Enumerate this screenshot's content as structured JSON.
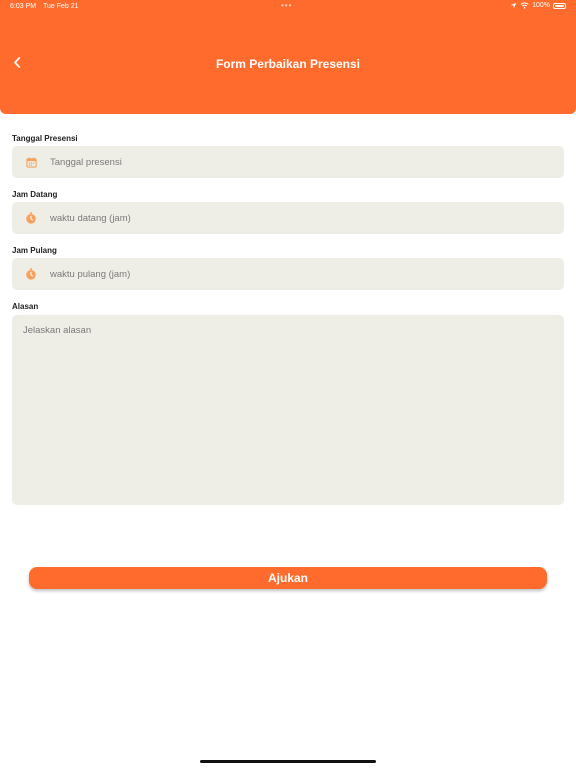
{
  "status_bar": {
    "time": "6:03 PM",
    "date": "Tue Feb 21",
    "dots": "•••",
    "battery": "100%"
  },
  "header": {
    "title": "Form Perbaikan Presensi",
    "back_icon": "chevron-left-icon",
    "color": "#FF6B2C"
  },
  "form": {
    "tanggal": {
      "label": "Tanggal Presensi",
      "placeholder": "Tanggal presensi",
      "icon": "calendar-icon"
    },
    "jam_datang": {
      "label": "Jam Datang",
      "placeholder": "waktu datang (jam)",
      "icon": "stopwatch-icon"
    },
    "jam_pulang": {
      "label": "Jam Pulang",
      "placeholder": "waktu pulang (jam)",
      "icon": "stopwatch-icon"
    },
    "alasan": {
      "label": "Alasan",
      "placeholder": "Jelaskan alasan"
    }
  },
  "submit": {
    "label": "Ajukan"
  },
  "colors": {
    "accent": "#FF6B2C",
    "field_bg": "#EFEEE6",
    "icon": "#F7A15E"
  }
}
